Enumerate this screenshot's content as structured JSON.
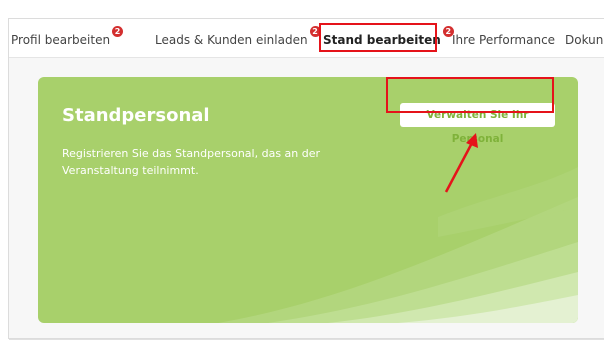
{
  "tabs": [
    {
      "label": "Profil bearbeiten",
      "badge": "2"
    },
    {
      "label": "Leads & Kunden einladen",
      "badge": "2"
    },
    {
      "label": "Stand bearbeiten",
      "badge": "2"
    },
    {
      "label": "Ihre Performance"
    },
    {
      "label": "Dokun"
    }
  ],
  "active_tab": "Stand bearbeiten",
  "card": {
    "title": "Standpersonal",
    "description": "Registrieren Sie das Standpersonal, das an der Veranstaltung teilnimmt.",
    "button_label": "Verwalten Sie Ihr Personal"
  },
  "colors": {
    "card_green": "#a8d06b",
    "button_text": "#7fb23a",
    "highlight_red": "#e5131a",
    "badge_red": "#d32f2f"
  }
}
